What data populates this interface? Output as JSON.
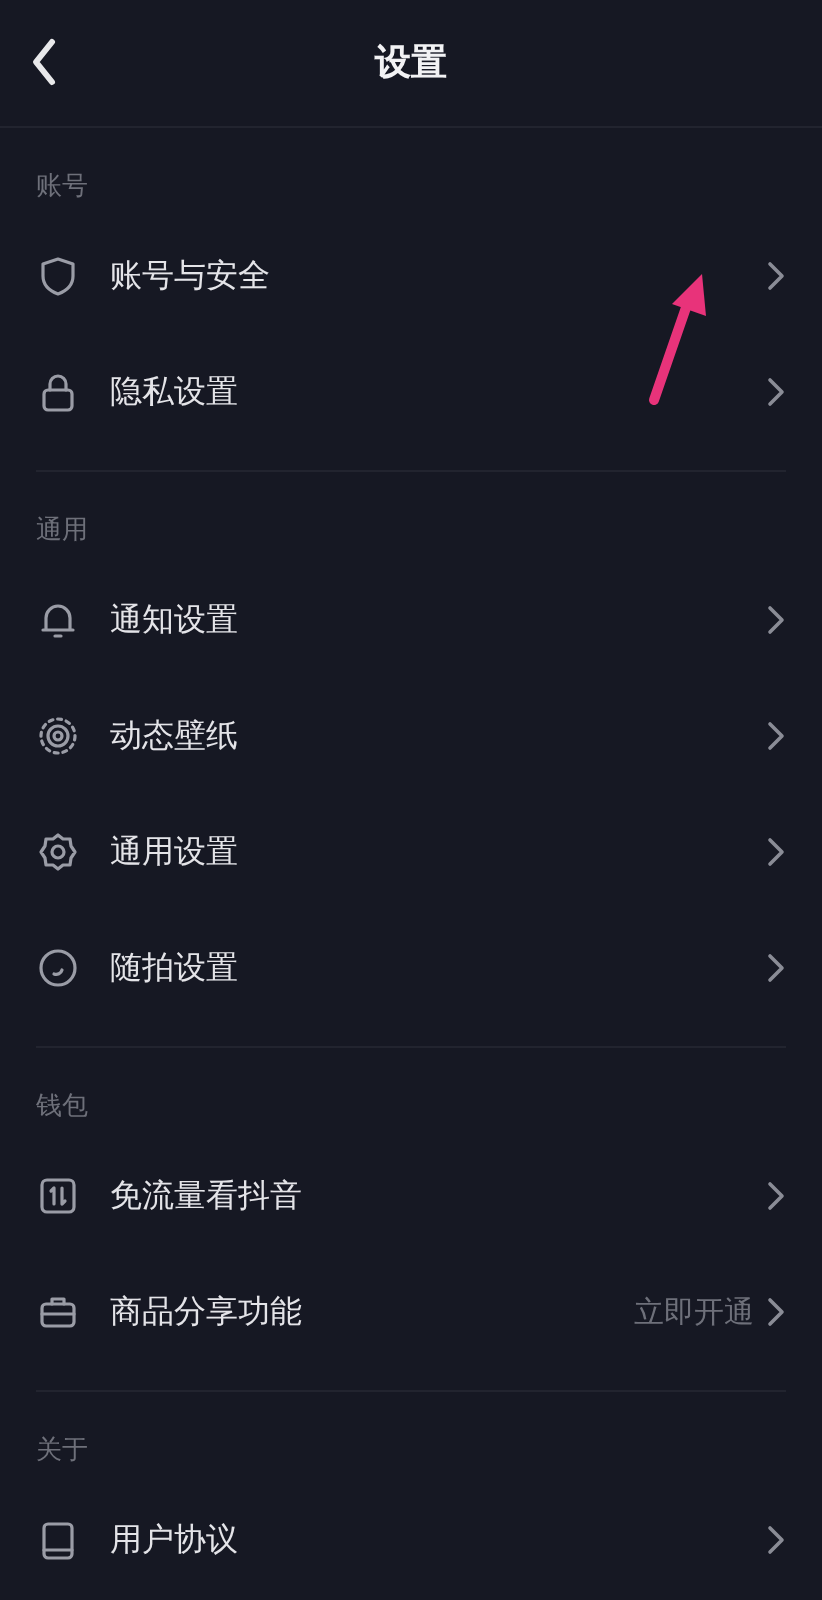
{
  "header": {
    "title": "设置"
  },
  "sections": [
    {
      "label": "账号",
      "items": [
        {
          "text": "账号与安全"
        },
        {
          "text": "隐私设置"
        }
      ]
    },
    {
      "label": "通用",
      "items": [
        {
          "text": "通知设置"
        },
        {
          "text": "动态壁纸"
        },
        {
          "text": "通用设置"
        },
        {
          "text": "随拍设置"
        }
      ]
    },
    {
      "label": "钱包",
      "items": [
        {
          "text": "免流量看抖音"
        },
        {
          "text": "商品分享功能",
          "value": "立即开通"
        }
      ]
    },
    {
      "label": "关于",
      "items": [
        {
          "text": "用户协议"
        }
      ]
    }
  ],
  "annotations": [
    {
      "kind": "arrow",
      "color": "#e8337a"
    }
  ]
}
